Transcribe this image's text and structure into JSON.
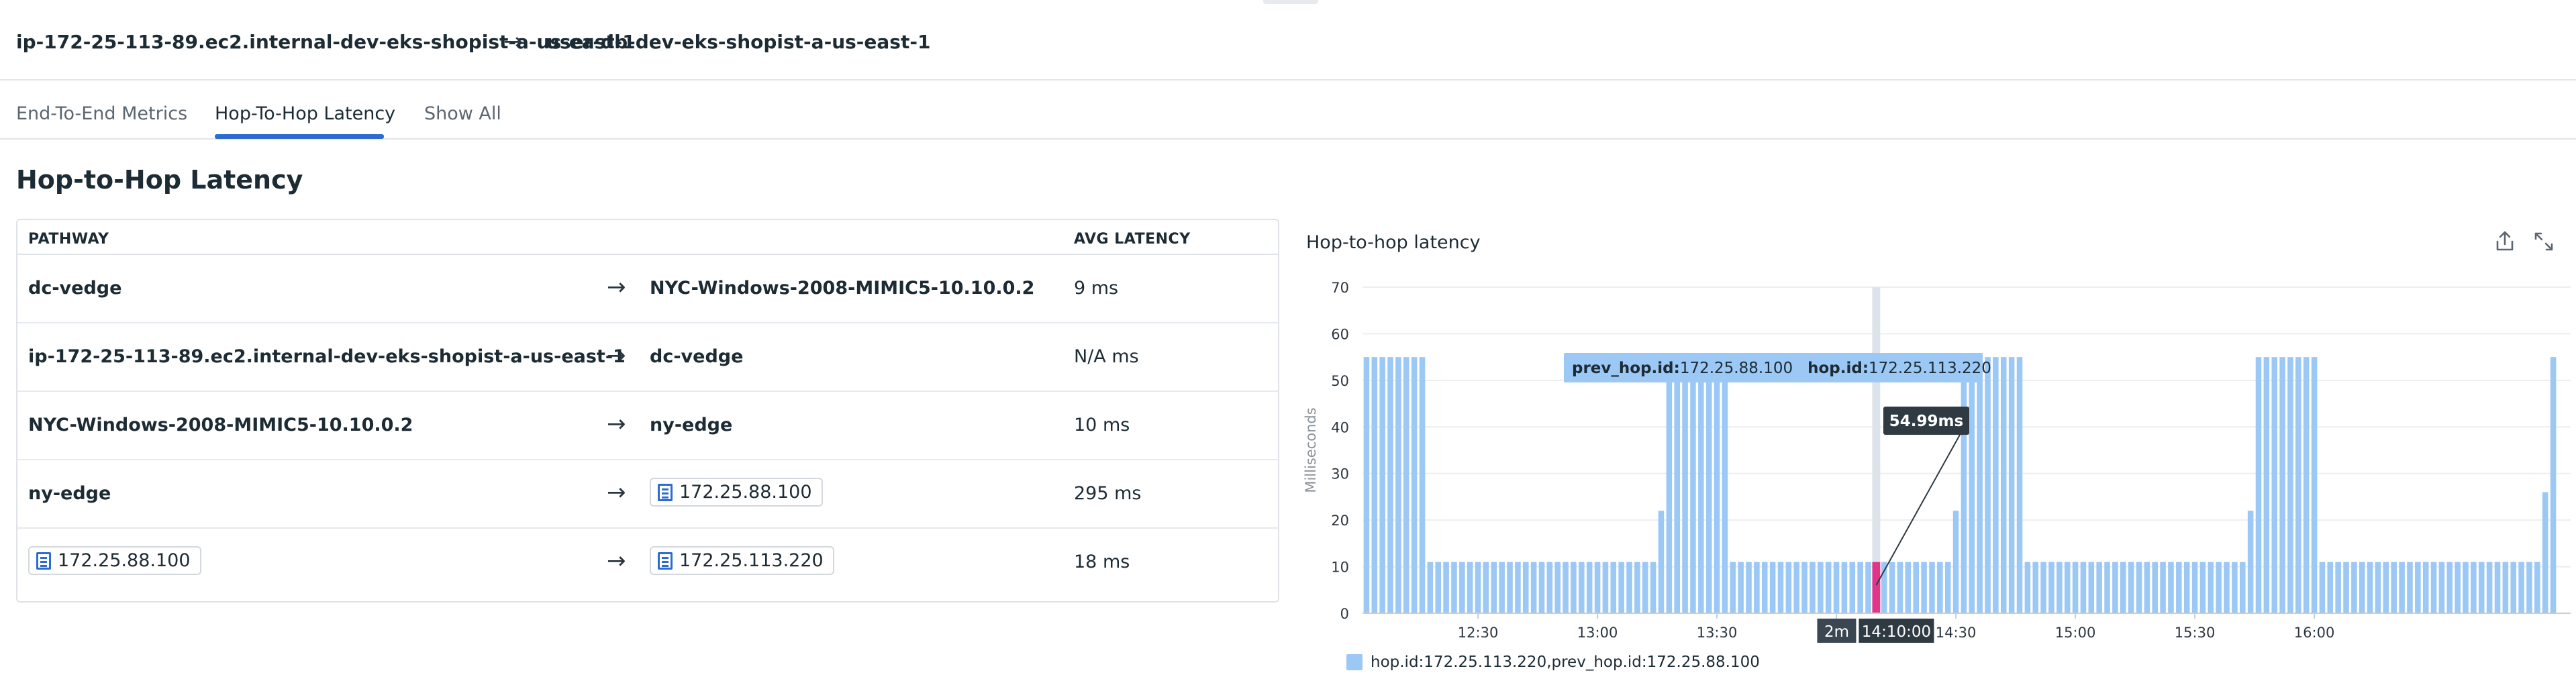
{
  "header": {
    "source": "ip-172-25-113-89.ec2.internal-dev-eks-shopist-a-us-east-1",
    "destination": "user-db-dev-eks-shopist-a-us-east-1"
  },
  "tabs": [
    {
      "label": "End-To-End Metrics",
      "active": false
    },
    {
      "label": "Hop-To-Hop Latency",
      "active": true
    },
    {
      "label": "Show All",
      "active": false
    }
  ],
  "section_title": "Hop-to-Hop Latency",
  "table": {
    "columns": {
      "pathway": "PATHWAY",
      "avg_latency": "AVG LATENCY"
    },
    "rows": [
      {
        "from": "dc-vedge",
        "from_host": false,
        "to": "NYC-Windows-2008-MIMIC5-10.10.0.2",
        "to_host": false,
        "latency": "9 ms"
      },
      {
        "from": "ip-172-25-113-89.ec2.internal-dev-eks-shopist-a-us-east-1",
        "from_host": false,
        "to": "dc-vedge",
        "to_host": false,
        "latency": "N/A ms"
      },
      {
        "from": "NYC-Windows-2008-MIMIC5-10.10.0.2",
        "from_host": false,
        "to": "ny-edge",
        "to_host": false,
        "latency": "10 ms"
      },
      {
        "from": "ny-edge",
        "from_host": false,
        "to": "172.25.88.100",
        "to_host": true,
        "latency": "295 ms"
      },
      {
        "from": "172.25.88.100",
        "from_host": true,
        "to": "172.25.113.220",
        "to_host": true,
        "latency": "18 ms"
      }
    ]
  },
  "chart_panel": {
    "title": "Hop-to-hop latency",
    "export_icon": "export-icon",
    "expand_icon": "expand-icon",
    "legend_label": "hop.id:172.25.113.220,prev_hop.id:172.25.88.100",
    "tooltip": {
      "prev_key": "prev_hop.id:",
      "prev_val": "172.25.88.100",
      "hop_key": "hop.id:",
      "hop_val": "172.25.113.220",
      "value_label": "54.99ms"
    },
    "cursor": {
      "interval": "2m",
      "time": "14:10:00"
    }
  },
  "colors": {
    "bar": "#9cc8f5",
    "highlight": "#e0368a",
    "accent": "#2d6bd1",
    "grid": "#eceef1"
  },
  "chart_data": {
    "type": "bar",
    "ylabel": "Milliseconds",
    "ylim": [
      0,
      70
    ],
    "yticks": [
      0,
      10,
      20,
      30,
      40,
      50,
      60,
      70
    ],
    "grid": true,
    "x_start": "12:02",
    "x_interval_minutes": 2,
    "xticks": [
      "12:30",
      "13:00",
      "13:30",
      "14:00",
      "14:30",
      "15:00",
      "15:30",
      "16:00"
    ],
    "highlight_time": "14:10",
    "series": [
      {
        "name": "hop.id:172.25.113.220,prev_hop.id:172.25.88.100",
        "values": [
          55,
          55,
          55,
          55,
          55,
          55,
          55,
          55,
          11,
          11,
          11,
          11,
          11,
          11,
          11,
          11,
          11,
          11,
          11,
          11,
          11,
          11,
          11,
          11,
          11,
          11,
          11,
          11,
          11,
          11,
          11,
          11,
          11,
          11,
          11,
          11,
          11,
          22,
          55,
          55,
          55,
          55,
          55,
          55,
          55,
          55,
          11,
          11,
          11,
          11,
          11,
          11,
          11,
          11,
          11,
          11,
          11,
          11,
          11,
          11,
          11,
          11,
          11,
          11,
          11,
          11,
          11,
          11,
          11,
          11,
          11,
          11,
          11,
          11,
          22,
          55,
          55,
          55,
          55,
          55,
          55,
          55,
          55,
          11,
          11,
          11,
          11,
          11,
          11,
          11,
          11,
          11,
          11,
          11,
          11,
          11,
          11,
          11,
          11,
          11,
          11,
          11,
          11,
          11,
          11,
          11,
          11,
          11,
          11,
          11,
          11,
          22,
          55,
          55,
          55,
          55,
          55,
          55,
          55,
          55,
          11,
          11,
          11,
          11,
          11,
          11,
          11,
          11,
          11,
          11,
          11,
          11,
          11,
          11,
          11,
          11,
          11,
          11,
          11,
          11,
          11,
          11,
          11,
          11,
          11,
          11,
          11,
          11,
          26,
          55
        ]
      }
    ]
  }
}
